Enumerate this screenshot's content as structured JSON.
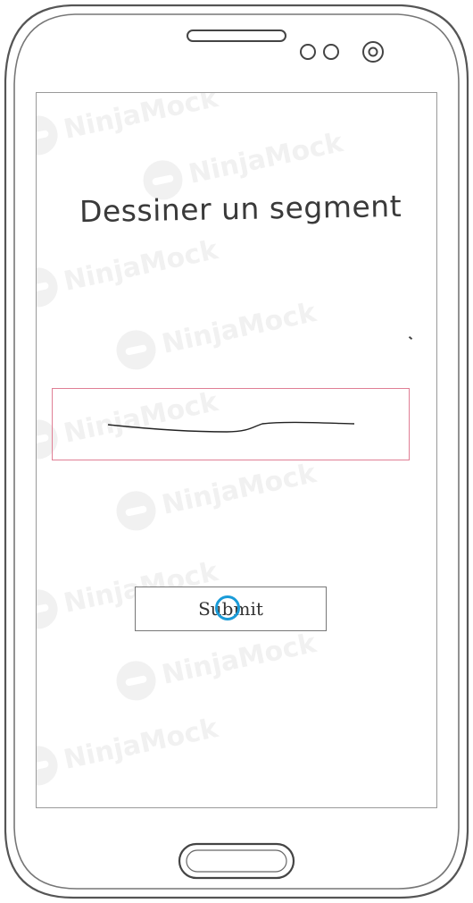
{
  "screen": {
    "title": "Dessiner un segment",
    "submit_label": "Submit"
  },
  "watermark": {
    "text": "NinjaMock",
    "icon": "ninja-icon"
  },
  "colors": {
    "drawing_box_border": "#e07f95",
    "tap_indicator": "#1a9bd8",
    "device_outline": "#555555"
  }
}
